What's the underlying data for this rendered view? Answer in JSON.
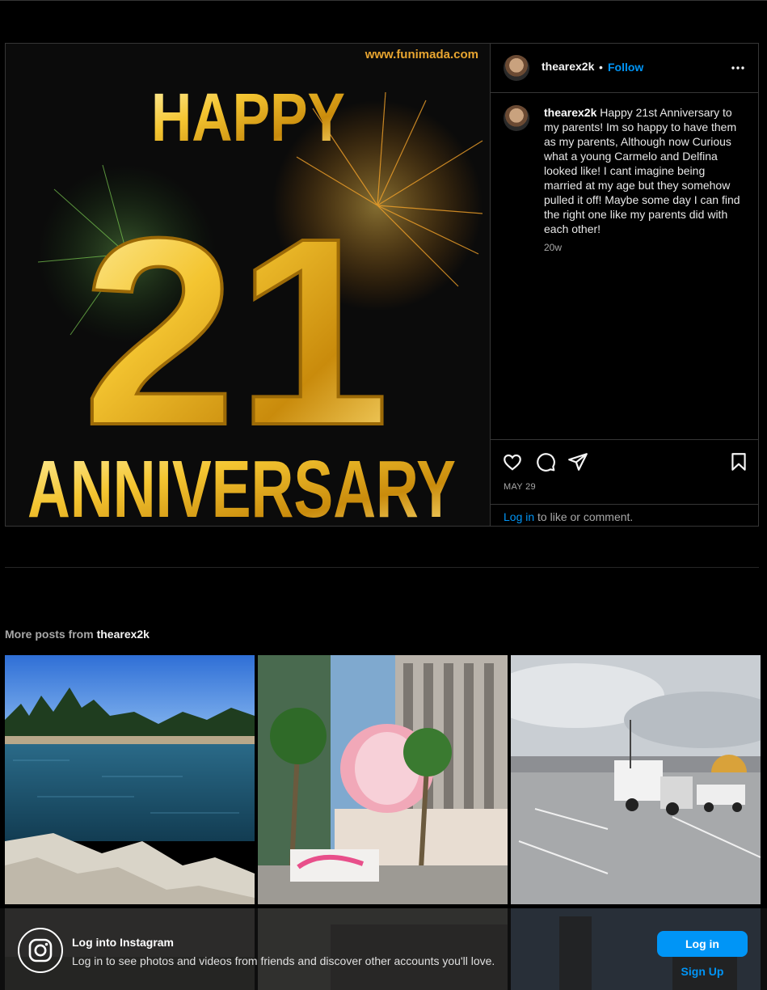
{
  "post": {
    "image_watermark": "www.funimada.com",
    "image_text_top": "HAPPY",
    "image_text_number": "21",
    "image_text_bottom": "ANNIVERSARY",
    "username": "thearex2k",
    "separator": "•",
    "follow_label": "Follow",
    "caption_username": "thearex2k",
    "caption_text": "Happy 21st Anniversary to my parents! Im so happy to have them as my parents, Although now Curious what a young Carmelo and Delfina looked like! I cant imagine being married at my age but they somehow pulled it off! Maybe some day I can find the right one like my parents did with each other!",
    "age": "20w",
    "date": "MAY 29",
    "login_link": "Log in",
    "login_suffix": " to like or comment."
  },
  "more_posts": {
    "prefix": "More posts from ",
    "username": "thearex2k"
  },
  "banner": {
    "title": "Log into Instagram",
    "subtitle": "Log in to see photos and videos from friends and discover other accounts you'll love.",
    "login_button": "Log in",
    "signup_button": "Sign Up"
  },
  "colors": {
    "accent": "#0095f6",
    "background": "#000000",
    "border": "#363636"
  }
}
